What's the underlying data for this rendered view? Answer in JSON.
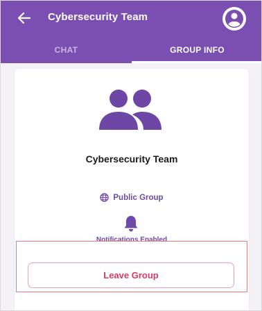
{
  "header": {
    "title": "Cybersecurity Team",
    "back_icon": "arrow-left-icon",
    "profile_icon": "account-circle-icon"
  },
  "tabs": [
    {
      "label": "CHAT",
      "selected": false
    },
    {
      "label": "GROUP INFO",
      "selected": true
    }
  ],
  "group": {
    "icon": "group-icon",
    "name": "Cybersecurity Team",
    "visibility_icon": "globe-icon",
    "visibility": "Public Group",
    "notification_icon": "bell-icon",
    "notifications": "Notifications Enabled"
  },
  "actions": {
    "leave_label": "Leave Group"
  },
  "colors": {
    "primary": "#7b4fb2",
    "accent_text": "#6d4aa8",
    "danger": "#d63a63",
    "highlight_border": "#e57c7c"
  }
}
